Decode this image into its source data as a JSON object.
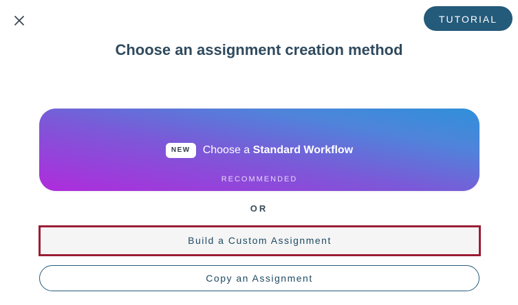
{
  "header": {
    "close_icon": "close-icon",
    "tutorial_label": "TUTORIAL",
    "title": "Choose an assignment creation method"
  },
  "workflow_card": {
    "badge": "NEW",
    "prefix": "Choose a ",
    "emphasis": "Standard Workflow",
    "subtitle": "RECOMMENDED"
  },
  "divider": {
    "label": "OR"
  },
  "options": {
    "custom_label": "Build a Custom Assignment",
    "copy_label": "Copy an Assignment"
  },
  "colors": {
    "primary": "#245a7a",
    "title": "#2f4a5e",
    "focus_outline": "#9b1c34",
    "gradient_start": "#b02bdc",
    "gradient_end": "#2f90da"
  }
}
